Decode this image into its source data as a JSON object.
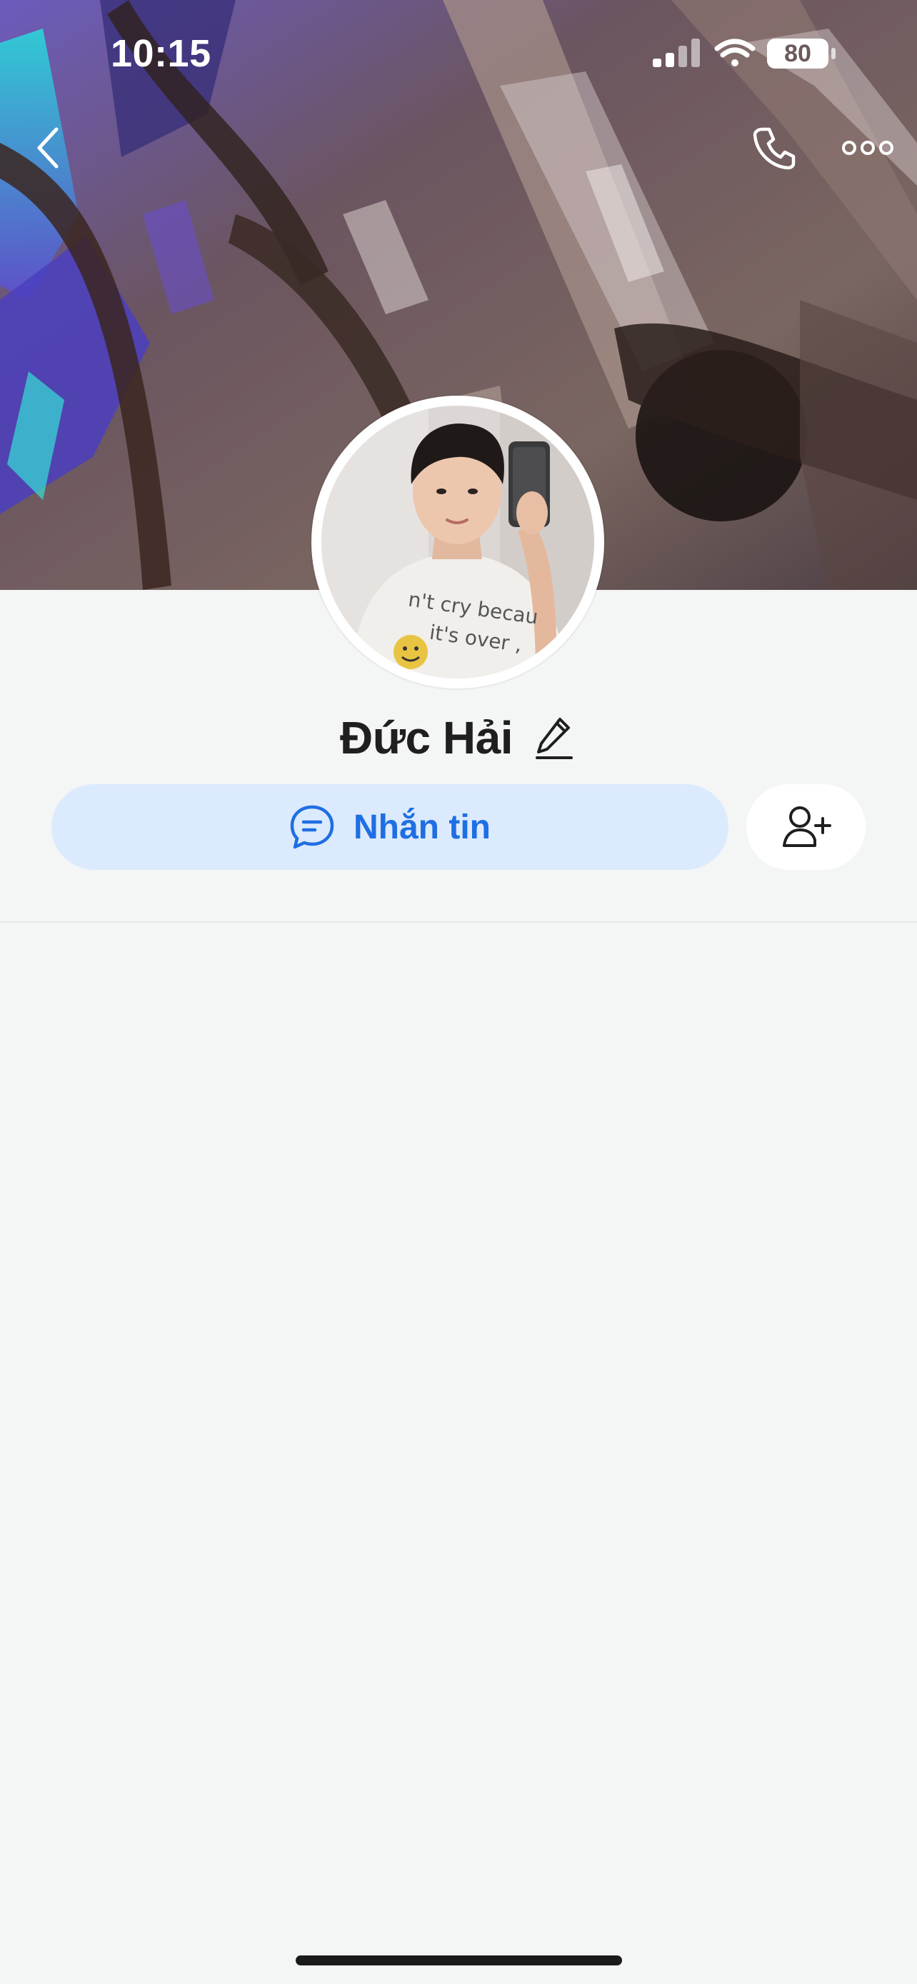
{
  "status_bar": {
    "time": "10:15",
    "battery": "80",
    "icons": [
      "cellular-signal-icon",
      "wifi-icon",
      "battery-icon"
    ]
  },
  "header": {
    "icons": [
      "back-chevron-icon",
      "phone-icon",
      "more-dots-icon"
    ]
  },
  "profile": {
    "name": "Đức Hải",
    "edit_icon": "pencil-icon",
    "cover_image": "cover-photo",
    "avatar_image": "profile-photo"
  },
  "actions": {
    "message_label": "Nhắn tin",
    "message_icon": "chat-bubble-icon",
    "add_friend_icon": "add-person-icon"
  },
  "colors": {
    "accent": "#1f6fe3",
    "message_button_bg": "#dceafd",
    "page_bg": "#f4f5f5"
  }
}
